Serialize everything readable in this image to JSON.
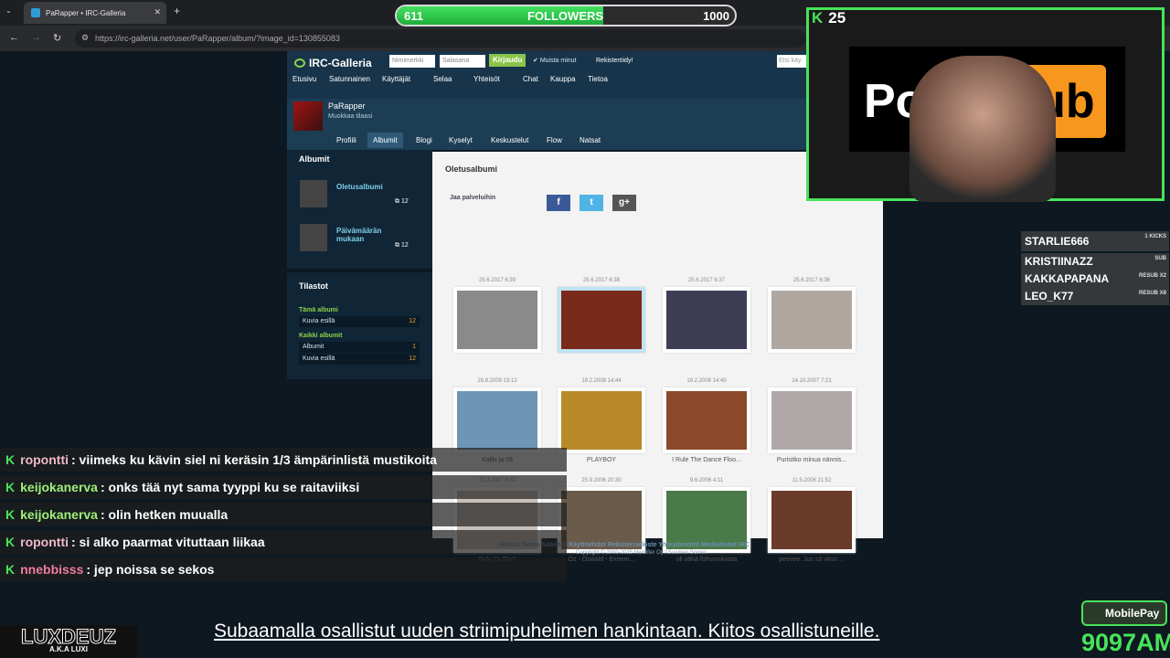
{
  "browser": {
    "tab_title": "PaRapper • IRC-Galleria",
    "url": "https://irc-galleria.net/user/PaRapper/album/?image_id=130855083"
  },
  "followers": {
    "current": "611",
    "label": "FOLLOWERS",
    "goal": "1000",
    "progress": 0.611
  },
  "site": {
    "logo": "IRC-Galleria",
    "username_placeholder": "Nimimerkki",
    "password_placeholder": "Salasana",
    "login_button": "Kirjaudu",
    "remember": "Muista minut",
    "register": "Rekisteröidy!",
    "search_placeholder": "Etsi käy",
    "menu": [
      "Etusivu",
      "Satunnainen",
      "Käyttäjät",
      "Selaa",
      "Yhteisöt",
      "Chat",
      "Kauppa",
      "Tietoa"
    ]
  },
  "profile": {
    "name": "PaRapper",
    "edit": "Muokkaa tilaasi",
    "tabs": [
      "Profiili",
      "Albumit",
      "Blogi",
      "Kyselyt",
      "Keskustelut",
      "Flow",
      "Natsat"
    ]
  },
  "sidebar": {
    "albums_title": "Albumit",
    "albums": [
      {
        "name": "Oletusalbumi",
        "count": "12"
      },
      {
        "name": "Päivämäärän mukaan",
        "count": "12"
      }
    ],
    "stats_title": "Tilastot",
    "this_album": "Tämä albumi",
    "images_shown": "Kuvia esillä",
    "this_count": "12",
    "all_albums": "Kaikki albumit",
    "albums_label": "Albumit",
    "albums_count": "1",
    "all_images_count": "12"
  },
  "album": {
    "title": "Oletusalbumi",
    "share_label": "Jaa palveluihin",
    "photos": [
      {
        "date": "25.6.2017 6:39",
        "caption": "",
        "color": "#8a8a8a"
      },
      {
        "date": "25.6.2017 6:38",
        "caption": "",
        "color": "#7a2a1a"
      },
      {
        "date": "25.6.2017 6:37",
        "caption": "",
        "color": "#3d3d55"
      },
      {
        "date": "25.6.2017 6:36",
        "caption": "",
        "color": "#b0a8a0"
      },
      {
        "date": "29.8.2009 23:12",
        "caption": "Kallis ja 09",
        "color": "#6e95b3"
      },
      {
        "date": "19.2.2008 14:44",
        "caption": "PLAYBOY",
        "color": "#b88a2a"
      },
      {
        "date": "19.2.2008 14:40",
        "caption": "I Rule The Dance Floo...",
        "color": "#8a4a2a"
      },
      {
        "date": "14.10.2007 7:21",
        "caption": "Purisitko minua nännis...",
        "color": "#b0a8a8"
      },
      {
        "date": "22.3.2007 0:32",
        "caption": "Ride Or Die!!",
        "color": "#c8c0b8"
      },
      {
        "date": "25.9.2006 20:30",
        "caption": "Oz - Oswald - Extrem...",
        "color": "#6a5a4a"
      },
      {
        "date": "9.6.2006 4:11",
        "caption": "oli vähä fishooniloista",
        "color": "#4a7a4a"
      },
      {
        "date": "11.5.2006 21:52",
        "caption": "peevee. Jos sä vitun ...",
        "color": "#6a3a2a"
      }
    ]
  },
  "footer": {
    "links": "Herkut   Tietoa   Säännöt   Käyttöehdot   Rekisteriseloste   Yhteydenotto   Mediatiedot   IRC",
    "copyright": "Copyright © 2000-2025 Herdifier Oy / Suomen Somet"
  },
  "stream": {
    "viewers": "25",
    "hub_left": "Po",
    "hub_right": "hub",
    "recent": [
      {
        "name": "STARLIE666",
        "tag": "1 KICKS"
      },
      {
        "name": "KRISTIINAZZ",
        "tag": "SUB"
      },
      {
        "name": "KAKKAPAPANA",
        "tag": "RESUB X2"
      },
      {
        "name": "LEO_K77",
        "tag": "RESUB X8"
      }
    ],
    "chat": [
      {
        "user": "ropontti",
        "color": "#f0b9c8",
        "msg": ": viimeks ku kävin siel ni keräsin 1/3 ämpärinlistä mustikoita"
      },
      {
        "user": "keijokanerva",
        "color": "#9ef07a",
        "msg": ": onks tää nyt sama tyyppi ku se raitaviiksi"
      },
      {
        "user": "keijokanerva",
        "color": "#9ef07a",
        "msg": ": olin hetken muualla"
      },
      {
        "user": "ropontti",
        "color": "#f0b9c8",
        "msg": ": si alko paarmat vituttaan liikaa"
      },
      {
        "user": "nnebbisss",
        "color": "#f07a9e",
        "msg": ": jep noissa se sekos"
      }
    ],
    "ticker": "Subaamalla osallistut uuden striimipuhelimen hankintaan. Kiitos osallistuneille.",
    "brand": "LUXDEUZ",
    "brand_sub": "A.K.A LUXI",
    "mobilepay": "MobilePay",
    "mobilepay_number": "9097AM"
  }
}
